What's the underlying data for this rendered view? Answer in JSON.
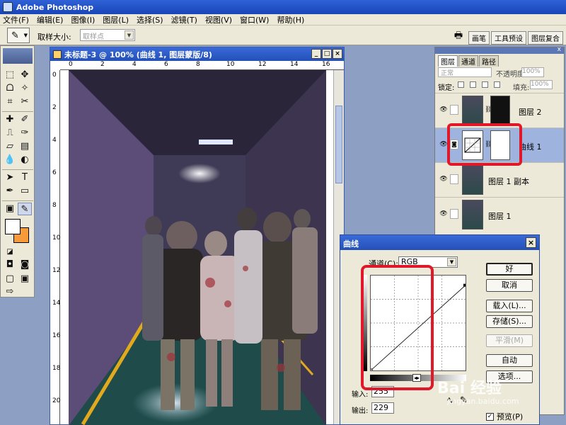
{
  "app": {
    "title": "Adobe Photoshop"
  },
  "menu": [
    "文件(F)",
    "编辑(E)",
    "图像(I)",
    "图层(L)",
    "选择(S)",
    "滤镜(T)",
    "视图(V)",
    "窗口(W)",
    "帮助(H)"
  ],
  "options": {
    "sample_size_label": "取样大小:",
    "sample_size_value": "取样点",
    "palette_tabs": [
      "画笔",
      "工具预设",
      "图层复合"
    ]
  },
  "document": {
    "title": "未标题-3 @ 100% (曲线 1, 图层蒙版/8)",
    "ruler_h": [
      "0",
      "2",
      "4",
      "6",
      "8",
      "10",
      "12",
      "14",
      "16"
    ],
    "ruler_v": [
      "0",
      "2",
      "4",
      "6",
      "8",
      "10",
      "12",
      "14",
      "16",
      "18",
      "20"
    ]
  },
  "layers_panel": {
    "tabs": [
      "图层",
      "通道",
      "路径"
    ],
    "blend_mode": "正常",
    "opacity_label": "不透明度:",
    "opacity_value": "100%",
    "lock_label": "锁定:",
    "fill_label": "填充:",
    "fill_value": "100%",
    "layers": [
      {
        "name": "图层 2",
        "visible": true,
        "selected": false,
        "has_mask": true
      },
      {
        "name": "曲线 1",
        "visible": true,
        "selected": true,
        "has_mask": true
      },
      {
        "name": "图层 1 副本",
        "visible": true,
        "selected": false,
        "has_mask": false
      },
      {
        "name": "图层 1",
        "visible": true,
        "selected": false,
        "has_mask": false
      }
    ]
  },
  "curves_dialog": {
    "title": "曲线",
    "channel_label": "通道(C):",
    "channel_value": "RGB",
    "buttons": {
      "ok": "好",
      "cancel": "取消",
      "load": "载入(L)...",
      "save": "存储(S)...",
      "smooth": "平滑(M)",
      "auto": "自动",
      "options": "选项..."
    },
    "input_label": "输入:",
    "input_value": "255",
    "output_label": "输出:",
    "output_value": "229",
    "preview_label": "预览(P)",
    "preview_checked": true,
    "curve_points": [
      [
        0,
        0
      ],
      [
        255,
        229
      ]
    ]
  },
  "watermark": {
    "text": "Bai 经验",
    "url": "jingyan.baidu.com"
  },
  "colors": {
    "foreground": "#ffffff",
    "background": "#f79b3a",
    "highlight": "#e1172a"
  }
}
